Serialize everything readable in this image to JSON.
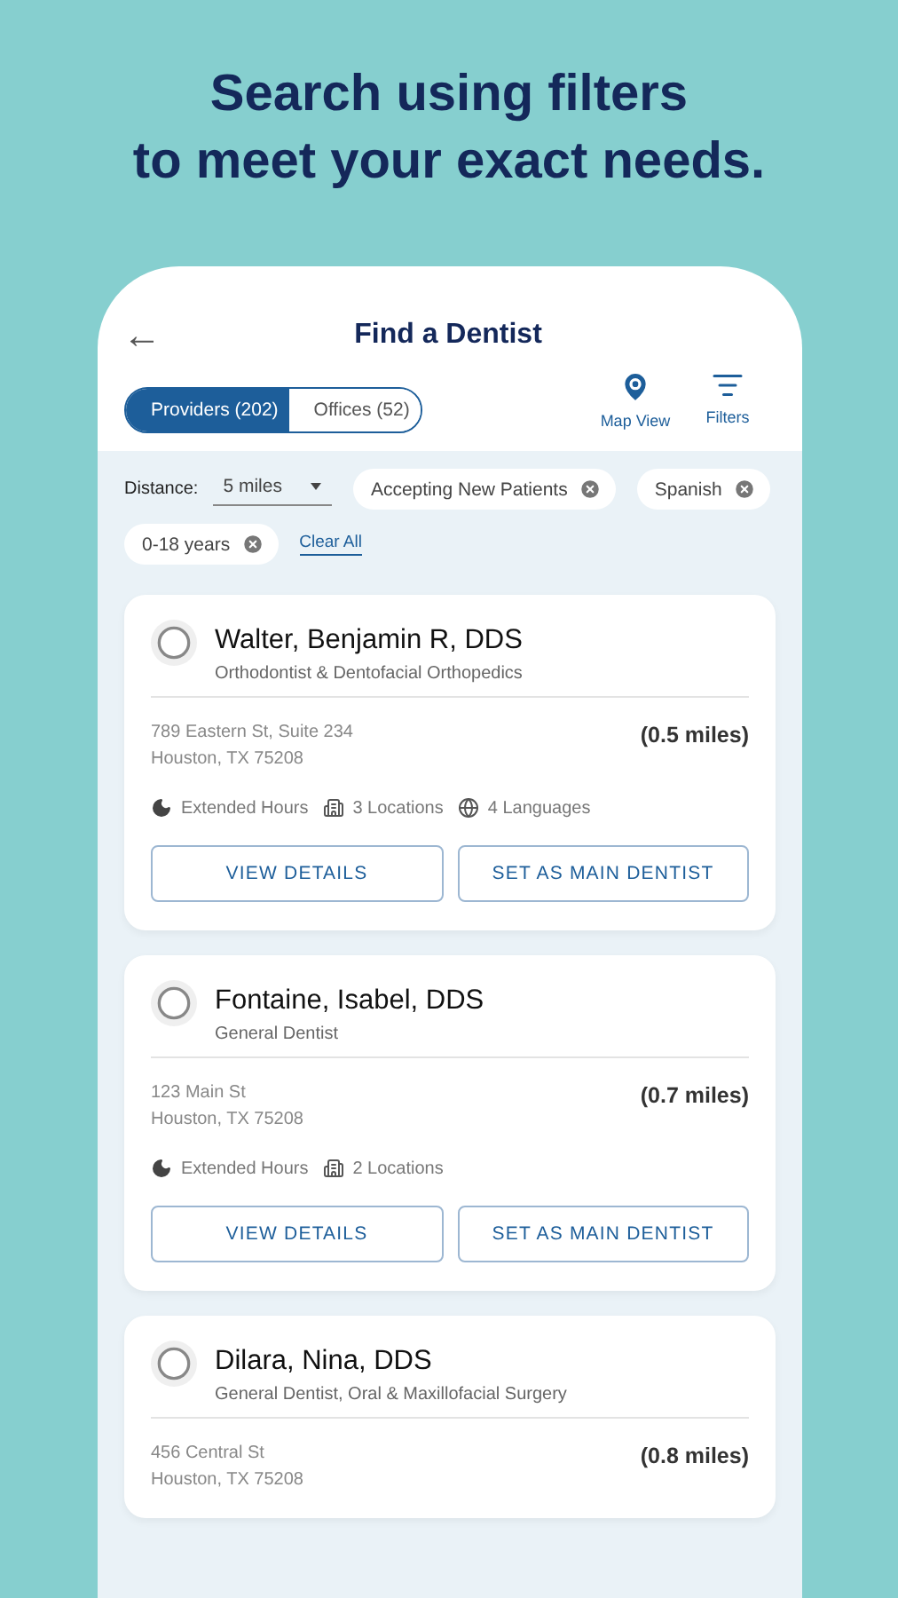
{
  "headline": [
    "Search using filters",
    "to meet your exact needs."
  ],
  "header": {
    "back": "←",
    "title": "Find a Dentist"
  },
  "tabs": [
    {
      "label": "Providers (202)",
      "selected": true
    },
    {
      "label": "Offices (52)",
      "selected": false
    }
  ],
  "actions": [
    {
      "kind": "map",
      "label": "Map View"
    },
    {
      "kind": "filters",
      "label": "Filters"
    }
  ],
  "distance": {
    "label": "Distance:",
    "value": "5 miles"
  },
  "chips": [
    "Accepting New Patients",
    "Spanish",
    "0-18 years"
  ],
  "clear_all": "Clear All",
  "providers": [
    {
      "name": "Walter, Benjamin R, DDS",
      "specialty": "Orthodontist & Dentofacial Orthopedics",
      "address": [
        "789 Eastern St, Suite 234",
        "Houston, TX 75208"
      ],
      "distance": "(0.5 miles)",
      "features": [
        {
          "kind": "hours",
          "label": "Extended Hours"
        },
        {
          "kind": "locations",
          "label": "3 Locations"
        },
        {
          "kind": "languages",
          "label": "4 Languages"
        }
      ],
      "buttons": [
        "VIEW DETAILS",
        "SET AS MAIN DENTIST"
      ]
    },
    {
      "name": "Fontaine, Isabel, DDS",
      "specialty": "General Dentist",
      "address": [
        "123 Main St",
        "Houston, TX 75208"
      ],
      "distance": "(0.7 miles)",
      "features": [
        {
          "kind": "hours",
          "label": "Extended Hours"
        },
        {
          "kind": "locations",
          "label": "2 Locations"
        }
      ],
      "buttons": [
        "VIEW DETAILS",
        "SET AS MAIN DENTIST"
      ]
    },
    {
      "name": "Dilara, Nina, DDS",
      "specialty": "General Dentist, Oral & Maxillofacial Surgery",
      "address": [
        "456 Central St",
        "Houston, TX 75208"
      ],
      "distance": "(0.8 miles)"
    }
  ]
}
